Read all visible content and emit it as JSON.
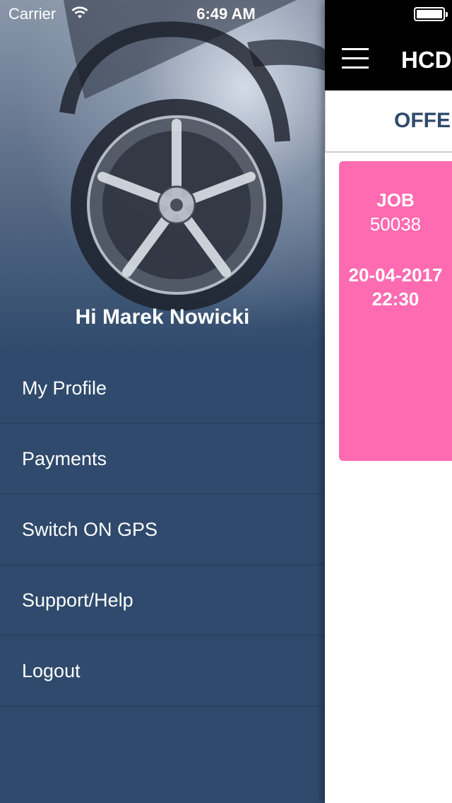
{
  "status_bar": {
    "carrier": "Carrier",
    "time": "6:49 AM"
  },
  "drawer": {
    "greeting": "Hi Marek Nowicki",
    "hero_icon": "car-wheel-image",
    "menu": [
      {
        "label": "My Profile"
      },
      {
        "label": "Payments"
      },
      {
        "label": "Switch ON GPS"
      },
      {
        "label": "Support/Help"
      },
      {
        "label": "Logout"
      }
    ]
  },
  "main": {
    "title": "HCD",
    "tab_label": "OFFE",
    "job_card": {
      "label": "JOB",
      "number": "50038",
      "date": "20-04-2017",
      "time": "22:30",
      "color": "#ff6bb0"
    }
  },
  "colors": {
    "drawer_bg": "#2f4a6c",
    "nav_bar_bg": "#000000",
    "tab_text": "#2f4a6c"
  }
}
